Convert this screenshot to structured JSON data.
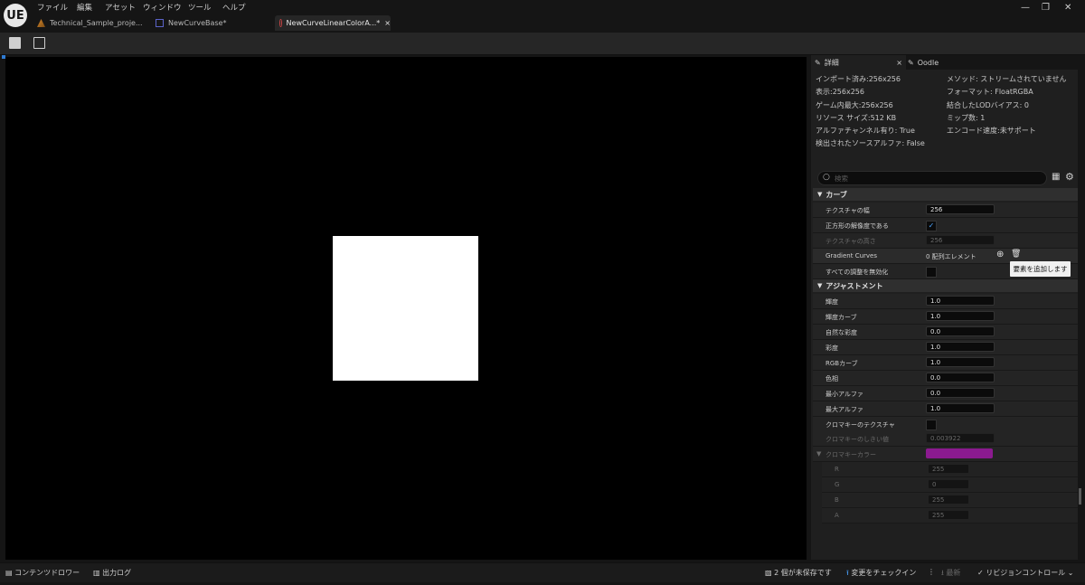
{
  "app": {
    "logo": "UE"
  },
  "menu": [
    "ファイル",
    "編集",
    "アセット",
    "ウィンドウ",
    "ツール",
    "ヘルプ"
  ],
  "tabs": [
    {
      "label": "Technical_Sample_proje...",
      "icon": "project-icon"
    },
    {
      "label": "NewCurveBase*",
      "icon": "curve-asset-icon"
    },
    {
      "label": "NewCurveLinearColorA...*",
      "icon": "curve-atlas-icon",
      "close": "×"
    }
  ],
  "window_controls": {
    "minimize": "—",
    "restore": "❐",
    "close": "✕"
  },
  "toolbar": {
    "save_icon": "save-icon",
    "browse_icon": "browse-icon"
  },
  "details": {
    "tab_label": "詳細",
    "tab_close": "×",
    "oodle_tab": "Oodle",
    "info_left": [
      "インポート済み:256x256",
      "表示:256x256",
      "ゲーム内最大:256x256",
      "リソース サイズ:512 KB",
      "アルファチャンネル有り: True",
      "検出されたソースアルファ: False"
    ],
    "info_right": [
      "メソッド: ストリームされていません",
      "フォーマット: FloatRGBA",
      "結合したLODバイアス: 0",
      "ミップ数: 1",
      "エンコード速度:未サポート"
    ],
    "search_placeholder": "検索",
    "section_curve": "カーブ",
    "curve_rows": {
      "width_label": "テクスチャの幅",
      "width_value": "256",
      "square_label": "正方形の解像度である",
      "square_check": "✓",
      "height_label": "テクスチャの高さ",
      "height_value": "256",
      "gradient_label": "Gradient Curves",
      "gradient_value": "0 配列エレメント",
      "disable_label": "すべての調整を無効化"
    },
    "tooltip": "要素を追加します",
    "section_adjust": "アジャストメント",
    "adjust_rows": [
      {
        "label": "輝度",
        "value": "1.0"
      },
      {
        "label": "輝度カーブ",
        "value": "1.0"
      },
      {
        "label": "自然な彩度",
        "value": "0.0"
      },
      {
        "label": "彩度",
        "value": "1.0"
      },
      {
        "label": "RGBカーブ",
        "value": "1.0"
      },
      {
        "label": "色相",
        "value": "0.0"
      },
      {
        "label": "最小アルファ",
        "value": "0.0"
      },
      {
        "label": "最大アルファ",
        "value": "1.0"
      }
    ],
    "chroma_texture_label": "クロマキーのテクスチャ",
    "chroma_threshold_label": "クロマキーのしきい値",
    "chroma_threshold_value": "0.003922",
    "chroma_color_label": "クロマキーカラー",
    "chroma_color": "#8b1a8f",
    "chroma_channels": [
      {
        "label": "R",
        "value": "255"
      },
      {
        "label": "G",
        "value": "0"
      },
      {
        "label": "B",
        "value": "255"
      },
      {
        "label": "A",
        "value": "255"
      }
    ]
  },
  "statusbar": {
    "content_drawer": "コンテンツドロワー",
    "output_log": "出力ログ",
    "unsaved": "2 個が未保存です",
    "checkin": "変更をチェックイン",
    "latest": "最新",
    "revision": "リビジョンコントロール"
  },
  "colors": {
    "accent": "#4aa3ff",
    "viewport_bg": "#000000",
    "preview": "#ffffff"
  }
}
